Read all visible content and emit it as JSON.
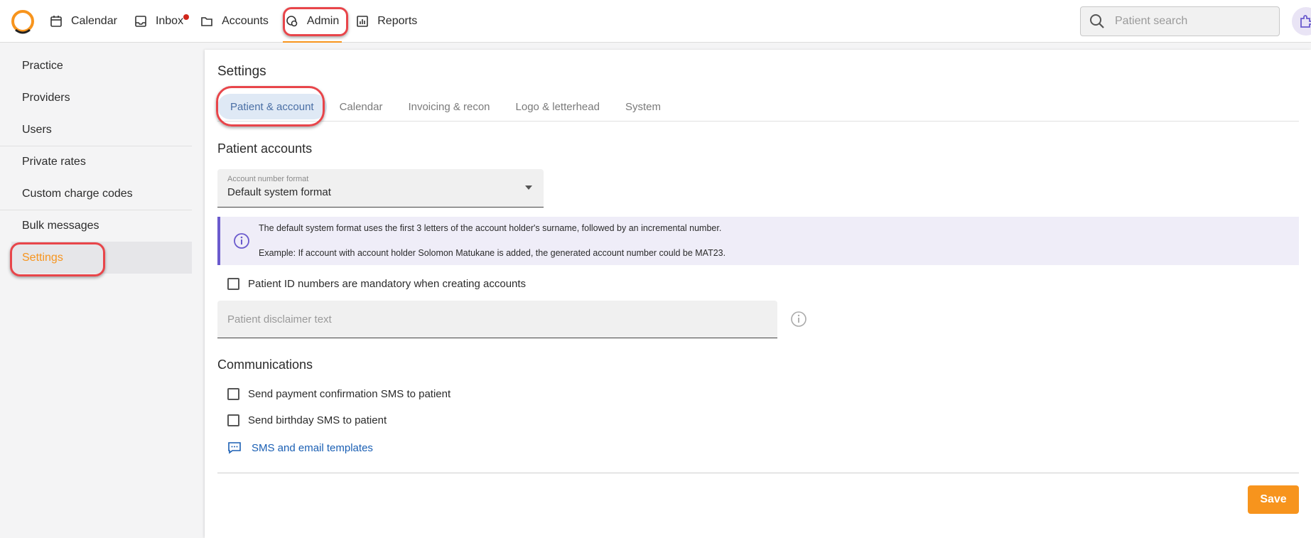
{
  "nav": {
    "items": [
      {
        "label": "Calendar",
        "icon": "calendar-icon"
      },
      {
        "label": "Inbox",
        "icon": "inbox-icon",
        "badge": true
      },
      {
        "label": "Accounts",
        "icon": "folder-icon"
      },
      {
        "label": "Admin",
        "icon": "admin-icon",
        "active": true
      },
      {
        "label": "Reports",
        "icon": "reports-icon"
      }
    ],
    "search_placeholder": "Patient search"
  },
  "sidebar": {
    "items": [
      {
        "label": "Practice"
      },
      {
        "label": "Providers"
      },
      {
        "label": "Users"
      },
      {
        "label": "Private rates"
      },
      {
        "label": "Custom charge codes"
      },
      {
        "label": "Bulk messages"
      },
      {
        "label": "Settings",
        "active": true
      }
    ]
  },
  "main": {
    "title": "Settings",
    "tabs": [
      {
        "label": "Patient & account",
        "active": true
      },
      {
        "label": "Calendar"
      },
      {
        "label": "Invoicing & recon"
      },
      {
        "label": "Logo & letterhead"
      },
      {
        "label": "System"
      }
    ],
    "patient_accounts": {
      "heading": "Patient accounts",
      "account_format_label": "Account number format",
      "account_format_value": "Default system format",
      "info_line1": "The default system format uses the first 3 letters of the account holder's surname, followed by an incremental number.",
      "info_line2": "Example: If account with account holder Solomon Matukane is added, the generated account number could be MAT23.",
      "id_mandatory_label": "Patient ID numbers are mandatory when creating accounts",
      "disclaimer_placeholder": "Patient disclaimer text"
    },
    "communications": {
      "heading": "Communications",
      "payment_sms_label": "Send payment confirmation SMS to patient",
      "birthday_sms_label": "Send birthday SMS to patient",
      "templates_link": "SMS and email templates"
    },
    "save_label": "Save"
  },
  "colors": {
    "accent": "#f7941d",
    "highlight": "#e8454a",
    "link": "#1a5fb4",
    "info_border": "#6a5acd"
  }
}
